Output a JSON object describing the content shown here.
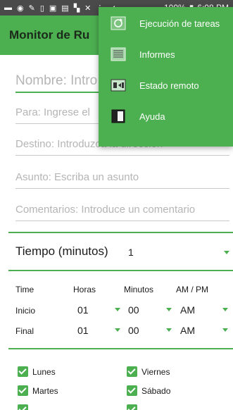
{
  "status_bar": {
    "battery_percent": "100%",
    "time": "6:08 PM"
  },
  "app_bar": {
    "title": "Monitor de Ru"
  },
  "form": {
    "nombre": {
      "placeholder": "Nombre: Intro"
    },
    "para": {
      "placeholder": "Para: Ingrese el"
    },
    "destino": {
      "placeholder": "Destino: Introduzca la dirección"
    },
    "asunto": {
      "placeholder": "Asunto: Escriba un asunto"
    },
    "comentarios": {
      "placeholder": "Comentarios: Introduce un comentario"
    }
  },
  "tiempo": {
    "label": "Tiempo (minutos)",
    "value": "1"
  },
  "time_table": {
    "headers": [
      "Time",
      "Horas",
      "Minutos",
      "AM / PM"
    ],
    "rows": [
      {
        "label": "Inicio",
        "horas": "01",
        "minutos": "00",
        "ampm": "AM"
      },
      {
        "label": "Final",
        "horas": "01",
        "minutos": "00",
        "ampm": "AM"
      }
    ]
  },
  "days": {
    "lunes": "Lunes",
    "martes": "Martes",
    "viernes": "Viernes",
    "sabado": "Sábado"
  },
  "menu": {
    "items": [
      {
        "label": "Ejecución de tareas",
        "icon": "refresh-icon"
      },
      {
        "label": "Informes",
        "icon": "list-icon"
      },
      {
        "label": "Estado remoto",
        "icon": "remote-icon"
      },
      {
        "label": "Ayuda",
        "icon": "help-book-icon"
      }
    ]
  },
  "colors": {
    "accent": "#4caf50",
    "status_bar": "#4a4a4a"
  }
}
